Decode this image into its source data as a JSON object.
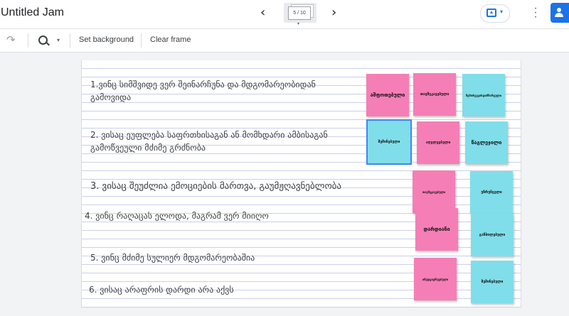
{
  "header": {
    "title": "Untitled Jam",
    "prev_icon": "chevron-left-icon",
    "next_icon": "chevron-right-icon",
    "frame_indicator": "5 / 10",
    "share_icon": "present-icon",
    "more_icon": "more-vert-icon",
    "user_icon": "add-person-icon"
  },
  "toolbar": {
    "redo_icon": "redo-icon",
    "zoom_icon": "zoom-in-icon",
    "set_background": "Set background",
    "clear_frame": "Clear frame"
  },
  "frame": {
    "questions": [
      "1.ვინც სიმშვიდე ვერ შეინარჩუნა და მდგომარეობიდან",
      "გამოვიდა",
      "2. ვისაც ეუფლება საფრთხისაგან ან მომხდარი ამბისაგან",
      "გამოწვეული მძიმე გრძნობა",
      "3. ვისაც შეუძლია ემოციების მართვა, გაუმჟღავნებლობა",
      "4. ვინც რაღაცას ელოდა, მაგრამ ვერ მიიღო",
      "5. ვინც მძიმე სულიერ მდგომარეობაშია",
      "6. ვისაც არაფრის დარდი არა აქვს"
    ],
    "notes": [
      {
        "text": "აშფოთებული",
        "color": "#f57eb6"
      },
      {
        "text": "თავშეკავებული",
        "color": "#f57eb6"
      },
      {
        "text": "შემთხვევისდამზარეული",
        "color": "#7fdeea"
      },
      {
        "text": "შეშინებული",
        "color": "#7fdeea"
      },
      {
        "text": "აღელვებული",
        "color": "#f57eb6"
      },
      {
        "text": "წაგლეჯილი",
        "color": "#7fdeea"
      },
      {
        "text": "თავშეკავებული",
        "color": "#f57eb6"
      },
      {
        "text": "უზრუნველი",
        "color": "#7fdeea"
      },
      {
        "text": "დარდიანი",
        "color": "#f57eb6"
      },
      {
        "text": "გაწბილებული",
        "color": "#7fdeea"
      },
      {
        "text": "იმედგაცრუებული",
        "color": "#f57eb6"
      },
      {
        "text": "შეშინებული",
        "color": "#7fdeea"
      }
    ]
  },
  "colors": {
    "accent": "#1a73e8",
    "note_pink": "#f57eb6",
    "note_cyan": "#7fdeea"
  }
}
